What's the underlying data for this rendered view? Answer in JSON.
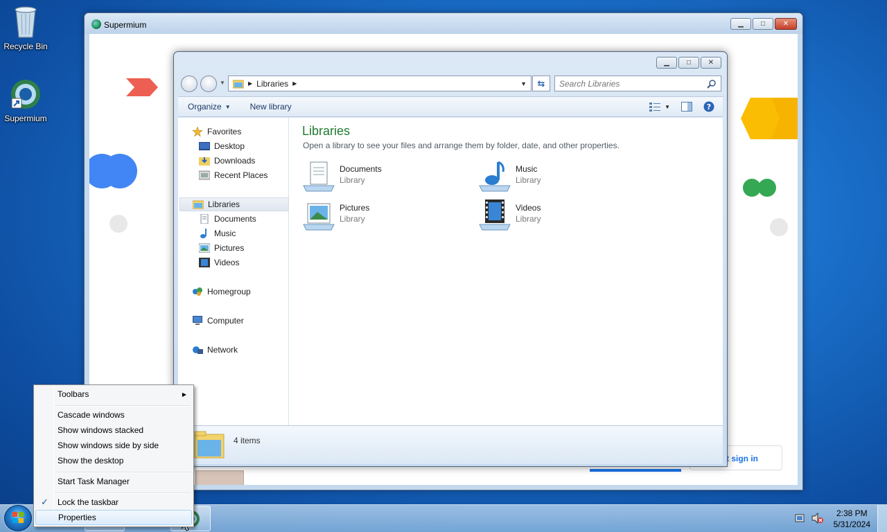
{
  "desktop": {
    "icons": [
      {
        "label": "Recycle Bin",
        "icon": "recycle-bin-icon"
      },
      {
        "label": "Supermium",
        "icon": "supermium-icon"
      }
    ]
  },
  "browser_window": {
    "title": "Supermium",
    "partial_text_bottom": "t sign in"
  },
  "explorer": {
    "address": {
      "crumb": "Libraries"
    },
    "search": {
      "placeholder": "Search Libraries"
    },
    "toolbar": {
      "organize": "Organize",
      "new_library": "New library"
    },
    "nav": {
      "favorites": "Favorites",
      "favorites_items": [
        "Desktop",
        "Downloads",
        "Recent Places"
      ],
      "libraries": "Libraries",
      "libraries_items": [
        "Documents",
        "Music",
        "Pictures",
        "Videos"
      ],
      "homegroup": "Homegroup",
      "computer": "Computer",
      "network": "Network"
    },
    "content": {
      "title": "Libraries",
      "subtitle": "Open a library to see your files and arrange them by folder, date, and other properties.",
      "items": [
        {
          "name": "Documents",
          "type": "Library"
        },
        {
          "name": "Music",
          "type": "Library"
        },
        {
          "name": "Pictures",
          "type": "Library"
        },
        {
          "name": "Videos",
          "type": "Library"
        }
      ]
    },
    "status": {
      "count": "4 items"
    }
  },
  "context_menu": {
    "items": [
      "Toolbars",
      "Cascade windows",
      "Show windows stacked",
      "Show windows side by side",
      "Show the desktop",
      "Start Task Manager",
      "Lock the taskbar",
      "Properties"
    ],
    "lock_checked": true
  },
  "taskbar": {
    "time": "2:38 PM",
    "date": "5/31/2024"
  },
  "colors": {
    "library_title": "#1f7a2f",
    "google_red": "#ea4335",
    "google_blue": "#4285f4",
    "google_yellow": "#fbbc04",
    "google_green": "#34a853"
  }
}
